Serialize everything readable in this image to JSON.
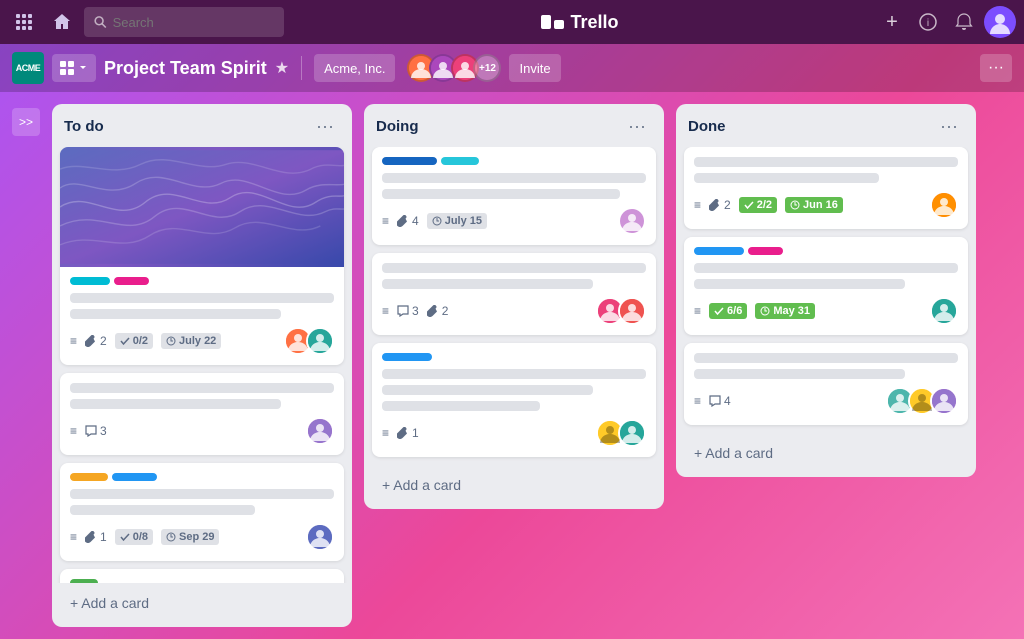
{
  "app": {
    "name": "Trello"
  },
  "topNav": {
    "searchPlaceholder": "Search",
    "addLabel": "+",
    "infoLabel": "ⓘ",
    "notifLabel": "🔔"
  },
  "boardHeader": {
    "logoText": "ACME",
    "menuLabel": "⊞",
    "boardTitle": "Project Team Spirit",
    "starLabel": "★",
    "workspaceLabel": "Acme, Inc.",
    "memberCount": "+12",
    "inviteLabel": "Invite",
    "moreLabel": "···"
  },
  "sidebarToggle": ">>",
  "columns": [
    {
      "id": "todo",
      "title": "To do",
      "cards": [
        {
          "id": "card1",
          "hasImage": true,
          "labels": [
            "cyan",
            "pink"
          ],
          "meta": {
            "attachments": "2",
            "checklist": "0/2",
            "date": "July 22"
          },
          "avatars": [
            "orange",
            "teal"
          ]
        },
        {
          "id": "card2",
          "comments": "3",
          "avatars": [
            "purple"
          ]
        },
        {
          "id": "card3",
          "labels": [
            "yellow",
            "blue"
          ],
          "meta": {
            "attachments": "1",
            "checklist": "0/8",
            "date": "Sep 29"
          },
          "avatars": [
            "indigo"
          ]
        },
        {
          "id": "card4",
          "labels": [
            "green"
          ],
          "isSmall": true
        }
      ],
      "addCardLabel": "+ Add a card"
    },
    {
      "id": "doing",
      "title": "Doing",
      "cards": [
        {
          "id": "dcard1",
          "labels": [
            "indigo",
            "cyan2"
          ],
          "meta": {
            "attachments": "4",
            "date": "July 15"
          },
          "avatars": [
            "purple2"
          ]
        },
        {
          "id": "dcard2",
          "comments": "3",
          "attachments": "2",
          "avatars": [
            "pink",
            "red"
          ]
        },
        {
          "id": "dcard3",
          "labels": [
            "blue2"
          ],
          "meta": {
            "attachments": "1"
          },
          "avatars": [
            "yellow",
            "teal"
          ]
        }
      ],
      "addCardLabel": "+ Add a card"
    },
    {
      "id": "done",
      "title": "Done",
      "cards": [
        {
          "id": "ncard1",
          "meta": {
            "attachments": "2",
            "checklist": "2/2",
            "date": "Jun 16"
          },
          "checkDone": true,
          "avatars": [
            "orange2"
          ]
        },
        {
          "id": "ncard2",
          "labels": [
            "blue",
            "pink"
          ],
          "meta": {
            "checklist": "6/6",
            "date": "May 31"
          },
          "checkDone": true,
          "avatars": [
            "teal2"
          ]
        },
        {
          "id": "ncard3",
          "comments": "4",
          "avatars": [
            "teal3",
            "yellow2",
            "purple3"
          ]
        }
      ],
      "addCardLabel": "+ Add a card"
    }
  ]
}
